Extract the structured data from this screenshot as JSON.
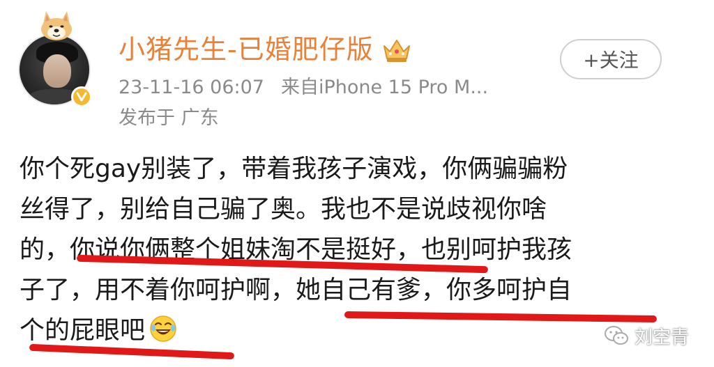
{
  "post": {
    "username": "小猪先生-已婚肥仔版",
    "timestamp": "23-11-16 06:07",
    "source": "来自iPhone 15 Pro M...",
    "location": "发布于 广东",
    "follow_label": "+关注",
    "lines": [
      "你个死gay别装了，带着我孩子演戏，你俩骗骗粉",
      "丝得了，别给自己骗了奥。我也不是说歧视你啥",
      "的，你说你俩整个姐妹淘不是挺好，也别呵护我孩",
      "子了，用不着你呵护啊，她自己有爹，你多呵护自",
      "个的屁眼吧"
    ]
  },
  "watermark": {
    "text": "刘空青"
  },
  "colors": {
    "username": "#e8823a",
    "meta": "#8a8a8a",
    "underline": "#e01818",
    "badge": "#f5b82e"
  }
}
